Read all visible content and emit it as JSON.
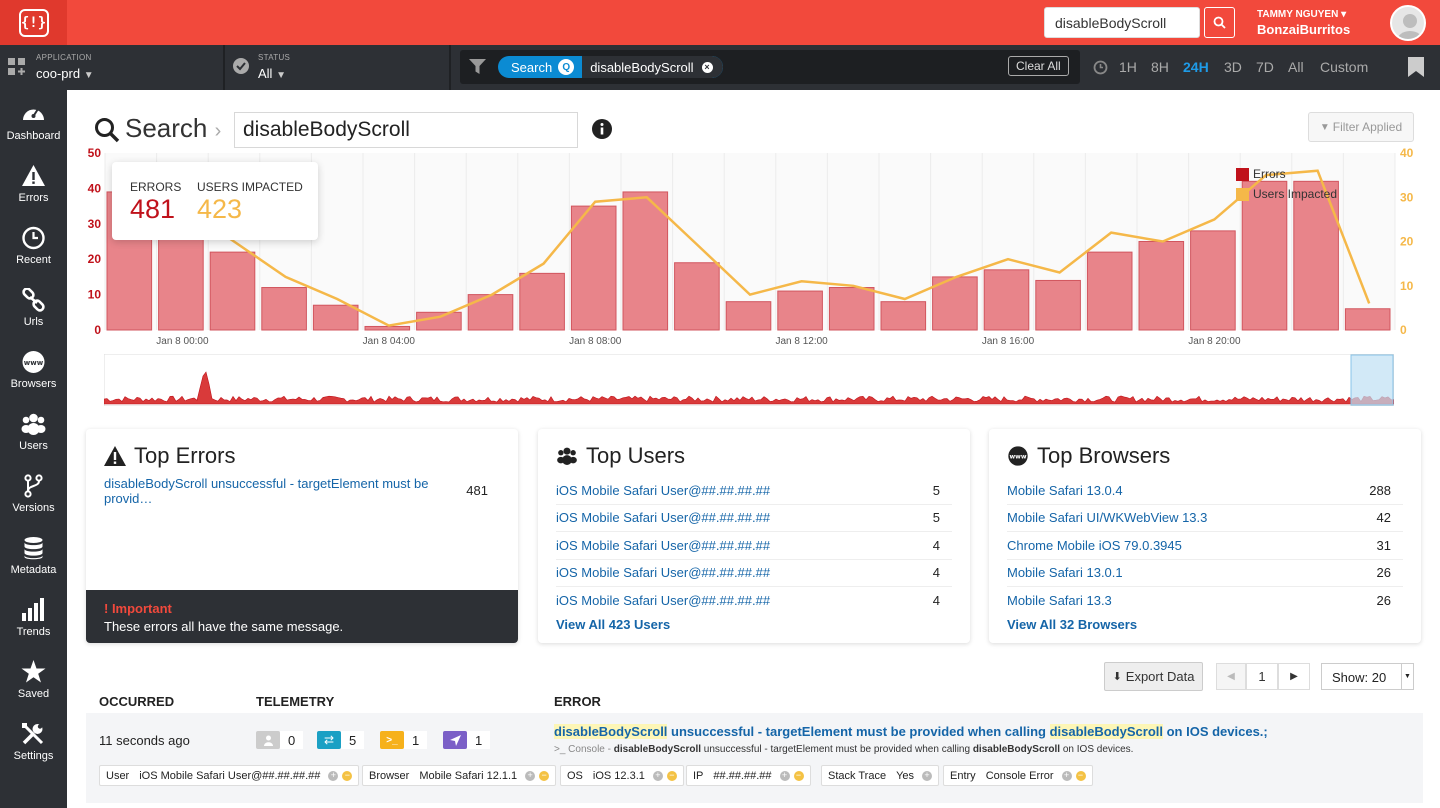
{
  "topbar": {
    "search_value": "disableBodyScroll",
    "user_name": "TAMMY NGUYEN",
    "user_org": "BonzaiBurritos"
  },
  "filters": {
    "application_label": "APPLICATION",
    "application_value": "coo-prd",
    "status_label": "STATUS",
    "status_value": "All",
    "search_chip_label": "Search",
    "search_chip_value": "disableBodyScroll",
    "clear_all": "Clear All",
    "time_ranges": [
      "1H",
      "8H",
      "24H",
      "3D",
      "7D",
      "All",
      "Custom"
    ],
    "active_range": "24H"
  },
  "sidebar": {
    "items": [
      {
        "label": "Dashboard",
        "icon": "gauge-icon"
      },
      {
        "label": "Errors",
        "icon": "warning-icon"
      },
      {
        "label": "Recent",
        "icon": "clock-icon"
      },
      {
        "label": "Urls",
        "icon": "link-icon"
      },
      {
        "label": "Browsers",
        "icon": "www-icon"
      },
      {
        "label": "Users",
        "icon": "users-icon"
      },
      {
        "label": "Versions",
        "icon": "branch-icon"
      },
      {
        "label": "Metadata",
        "icon": "database-icon"
      },
      {
        "label": "Trends",
        "icon": "bar-chart-icon"
      },
      {
        "label": "Saved",
        "icon": "star-icon"
      },
      {
        "label": "Settings",
        "icon": "tools-icon"
      }
    ]
  },
  "page": {
    "title": "Search",
    "search_value": "disableBodyScroll",
    "filter_applied": "Filter Applied"
  },
  "summary": {
    "errors_label": "ERRORS",
    "errors_value": "481",
    "users_label": "USERS IMPACTED",
    "users_value": "423"
  },
  "chart_data": {
    "type": "bar",
    "categories": [
      "Jan 7 23:00",
      "Jan 8 00:00",
      "Jan 8 01:00",
      "Jan 8 02:00",
      "Jan 8 03:00",
      "Jan 8 04:00",
      "Jan 8 05:00",
      "Jan 8 06:00",
      "Jan 8 07:00",
      "Jan 8 08:00",
      "Jan 8 09:00",
      "Jan 8 10:00",
      "Jan 8 11:00",
      "Jan 8 12:00",
      "Jan 8 13:00",
      "Jan 8 14:00",
      "Jan 8 15:00",
      "Jan 8 16:00",
      "Jan 8 17:00",
      "Jan 8 18:00",
      "Jan 8 19:00",
      "Jan 8 20:00",
      "Jan 8 21:00",
      "Jan 8 22:00",
      "Jan 8 23:00"
    ],
    "series": [
      {
        "name": "Errors",
        "axis": "left",
        "type": "bar",
        "color": "#e8848a",
        "values": [
          39,
          30,
          22,
          12,
          7,
          1,
          5,
          10,
          16,
          35,
          39,
          19,
          8,
          11,
          12,
          8,
          15,
          17,
          14,
          22,
          25,
          28,
          42,
          42,
          6
        ]
      },
      {
        "name": "Users Impacted",
        "axis": "right",
        "type": "line",
        "color": "#f5b849",
        "values": [
          34,
          28,
          20,
          12,
          7,
          1,
          3,
          8,
          15,
          29,
          30,
          19,
          8,
          11,
          10,
          7,
          12,
          16,
          13,
          22,
          20,
          25,
          35,
          36,
          6
        ]
      }
    ],
    "x_tick_labels": [
      "Jan 8 00:00",
      "Jan 8 04:00",
      "Jan 8 08:00",
      "Jan 8 12:00",
      "Jan 8 16:00",
      "Jan 8 20:00"
    ],
    "ylim_left": [
      0,
      50
    ],
    "yticks_left": [
      0,
      10,
      20,
      30,
      40,
      50
    ],
    "ylim_right": [
      0,
      40
    ],
    "yticks_right": [
      0,
      10,
      20,
      30,
      40
    ],
    "legend_position": "top-right",
    "grid": true
  },
  "top_errors": {
    "title": "Top Errors",
    "rows": [
      {
        "label": "disableBodyScroll unsuccessful - targetElement must be provid…",
        "count": "481"
      }
    ],
    "important_title": "! Important",
    "important_text": "These errors all have the same message."
  },
  "top_users": {
    "title": "Top Users",
    "rows": [
      {
        "label": "iOS Mobile Safari User@##.##.##.##",
        "count": "5"
      },
      {
        "label": "iOS Mobile Safari User@##.##.##.##",
        "count": "5"
      },
      {
        "label": "iOS Mobile Safari User@##.##.##.##",
        "count": "4"
      },
      {
        "label": "iOS Mobile Safari User@##.##.##.##",
        "count": "4"
      },
      {
        "label": "iOS Mobile Safari User@##.##.##.##",
        "count": "4"
      }
    ],
    "view_all": "View All 423 Users"
  },
  "top_browsers": {
    "title": "Top Browsers",
    "rows": [
      {
        "label": "Mobile Safari 13.0.4",
        "count": "288"
      },
      {
        "label": "Mobile Safari UI/WKWebView 13.3",
        "count": "42"
      },
      {
        "label": "Chrome Mobile iOS 79.0.3945",
        "count": "31"
      },
      {
        "label": "Mobile Safari 13.0.1",
        "count": "26"
      },
      {
        "label": "Mobile Safari 13.3",
        "count": "26"
      }
    ],
    "view_all": "View All 32 Browsers"
  },
  "table": {
    "export_label": "Export Data",
    "page": "1",
    "show_label": "Show: 20",
    "headers": {
      "occurred": "OCCURRED",
      "telemetry": "TELEMETRY",
      "error": "ERROR"
    },
    "row": {
      "occurred": "11 seconds ago",
      "telemetry": {
        "user": "0",
        "network": "5",
        "console": "1",
        "navigation": "1"
      },
      "error_title_hl1": "disableBodyScroll",
      "error_title_mid": " unsuccessful - targetElement must be provided when calling ",
      "error_title_hl2": "disableBodyScroll",
      "error_title_end": " on IOS devices.;",
      "error_sub_prefix": ">_ Console - ",
      "error_sub_hl1": "disableBodyScroll",
      "error_sub_mid": " unsuccessful - targetElement must be provided when calling ",
      "error_sub_hl2": "disableBodyScroll",
      "error_sub_end": " on IOS devices.",
      "tags": [
        {
          "key": "User",
          "value": "iOS Mobile Safari User@##.##.##.##"
        },
        {
          "key": "Browser",
          "value": "Mobile Safari 12.1.1"
        },
        {
          "key": "OS",
          "value": "iOS 12.3.1"
        },
        {
          "key": "IP",
          "value": "##.##.##.##"
        },
        {
          "key": "Stack Trace",
          "value": "Yes"
        },
        {
          "key": "Entry",
          "value": "Console Error"
        }
      ]
    }
  },
  "colors": {
    "brand": "#f2493c",
    "dark": "#2d3035",
    "link": "#1565a8",
    "errors": "#c0121b",
    "users": "#f5b849"
  }
}
